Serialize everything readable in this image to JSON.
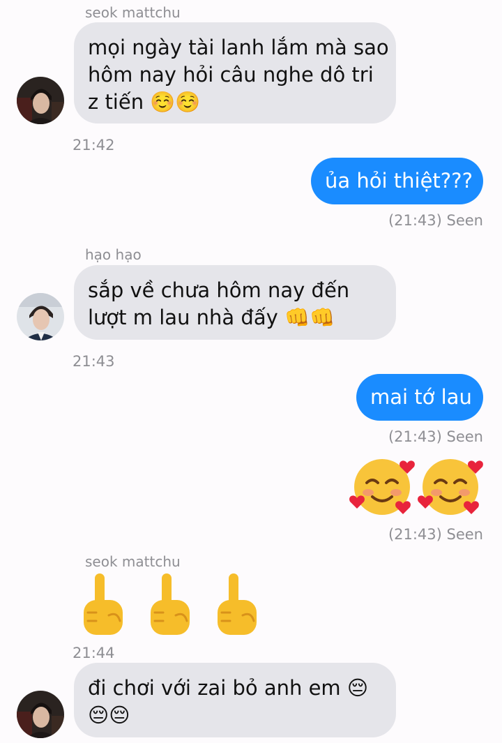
{
  "messages": [
    {
      "sender": "seok mattchu",
      "lines": [
        "mọi ngày tài lanh lắm mà sao",
        "hôm nay hỏi câu nghe dô tri",
        "z tiến ☺️☺️"
      ],
      "time": "21:42"
    },
    {
      "text": "ủa hỏi thiệt???",
      "status": "(21:43) Seen"
    },
    {
      "sender": "hạo hạo",
      "lines": [
        "sắp về chưa hôm nay đến",
        "lượt m lau nhà đấy 👊👊"
      ],
      "time": "21:43"
    },
    {
      "text": "mai tớ lau",
      "status": "(21:43) Seen"
    },
    {
      "emoji": "🥰🥰",
      "status": "(21:43) Seen"
    },
    {
      "sender": "seok mattchu",
      "emoji": "🖕 🖕 🖕",
      "time": "21:44"
    },
    {
      "lines": [
        "đi chơi với zai bỏ anh em 😔",
        "😔😔"
      ]
    }
  ],
  "colors": {
    "background": "#fdfbfd",
    "incoming_bubble": "#e5e5ea",
    "outgoing_bubble": "#1a8cff",
    "meta_text": "#8e8e93"
  }
}
